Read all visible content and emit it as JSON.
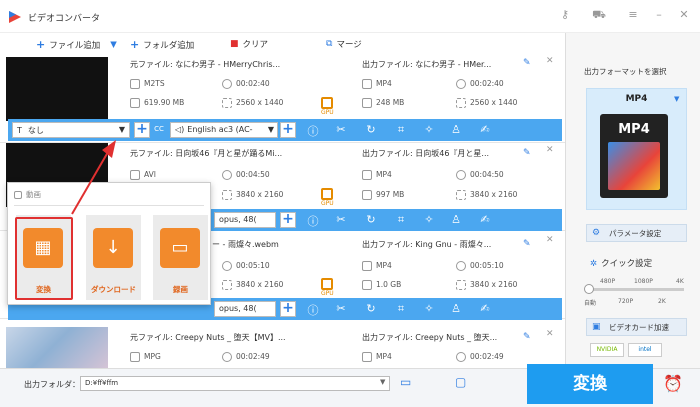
{
  "app": {
    "title": "ビデオコンバータ"
  },
  "toolbar": {
    "add_file": "ファイル追加",
    "add_folder": "フォルダ追加",
    "clear": "クリア",
    "merge": "マージ"
  },
  "rows": [
    {
      "src_name": "元ファイル: なにわ男子 - HMerryChris...",
      "src_format": "M2TS",
      "src_duration": "00:02:40",
      "src_size": "619.90 MB",
      "src_res": "2560 x 1440",
      "out_name": "出力ファイル: なにわ男子 - HMer...",
      "out_format": "MP4",
      "out_duration": "00:02:40",
      "out_size": "248 MB",
      "out_res": "2560 x 1440",
      "subtitle": "なし",
      "audio": "English ac3 (AC-"
    },
    {
      "src_name": "元ファイル: 日向坂46『月と星が踊るMi...",
      "src_format": "AVI",
      "src_duration": "00:04:50",
      "src_size": "",
      "src_res": "3840 x 2160",
      "out_name": "出力ファイル: 日向坂46『月と星...",
      "out_format": "MP4",
      "out_duration": "00:04:50",
      "out_size": "997 MB",
      "out_res": "3840 x 2160",
      "subtitle": "",
      "audio": "opus, 48("
    },
    {
      "src_name": "ー - 雨燦々.webm",
      "src_format": "",
      "src_duration": "00:05:10",
      "src_size": "",
      "src_res": "3840 x 2160",
      "out_name": "出力ファイル: King Gnu - 雨燦々...",
      "out_format": "MP4",
      "out_duration": "00:05:10",
      "out_size": "1.0 GB",
      "out_res": "3840 x 2160",
      "subtitle": "",
      "audio": "opus, 48("
    },
    {
      "src_name": "元ファイル: Creepy Nuts _ 堕天【MV】...",
      "src_format": "MPG",
      "src_duration": "00:02:49",
      "src_size": "",
      "src_res": "",
      "out_name": "出力ファイル: Creepy Nuts _ 堕天...",
      "out_format": "MP4",
      "out_duration": "00:02:49",
      "out_size": "",
      "out_res": "",
      "subtitle": "",
      "audio": ""
    }
  ],
  "gpu_label": "GPU",
  "right_panel": {
    "format_label": "出力フォーマットを選択",
    "format_name": "MP4",
    "format_badge": "MP4",
    "param_button": "パラメータ設定",
    "quick_label": "クイック設定",
    "ticks_top": [
      "480P",
      "1080P",
      "4K"
    ],
    "ticks_bottom": [
      "自動",
      "720P",
      "2K"
    ],
    "gpu_button": "ビデオカード加速",
    "nvidia": "NVIDIA",
    "intel": "intel"
  },
  "bottom": {
    "output_label": "出力フォルダ：",
    "output_path": "D:¥ff¥ffm",
    "convert_button": "変換"
  },
  "popup": {
    "header": "動画",
    "tiles": [
      "変換",
      "ダウンロード",
      "録画"
    ]
  },
  "colors": {
    "accent": "#1e9cf0",
    "orange": "#f28a2c",
    "highlight": "#e03030"
  }
}
